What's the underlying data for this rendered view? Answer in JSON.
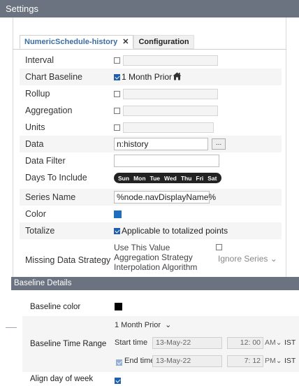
{
  "window": {
    "title": "Settings"
  },
  "tabs": [
    {
      "label": "NumericSchedule-history",
      "close": "✕"
    },
    {
      "label": "Configuration"
    }
  ],
  "rows": {
    "interval": "Interval",
    "chart_baseline": {
      "label": "Chart Baseline",
      "value": "1 Month Prior"
    },
    "rollup": "Rollup",
    "aggregation": "Aggregation",
    "units": "Units",
    "data": {
      "label": "Data",
      "value": "n:history",
      "button": "..."
    },
    "data_filter": "Data Filter",
    "days_to_include": {
      "label": "Days To Include",
      "days": [
        "Sun",
        "Mon",
        "Tue",
        "Wed",
        "Thu",
        "Fri",
        "Sat"
      ]
    },
    "series_name": {
      "label": "Series Name",
      "value": "%node.navDisplayName%"
    },
    "color": {
      "label": "Color",
      "value": "#1f6fbf"
    },
    "totalize": {
      "label": "Totalize",
      "value": "Applicable to totalized points"
    },
    "missing_data": {
      "label": "Missing Data Strategy",
      "line1": "Use This Value",
      "line2": "Aggregation Strategy",
      "line3": "Interpolation Algorithm",
      "select": "Ignore Series",
      "chevron": "⌄"
    }
  },
  "baseline": {
    "title": "Baseline Details",
    "color": {
      "label": "Baseline color",
      "value": "#000000"
    },
    "time_range": {
      "label": "Baseline Time Range",
      "select": "1 Month Prior",
      "chevron": "⌄",
      "start_label": "Start time",
      "start_date": "13-May-22",
      "start_hour": "12",
      "start_minute": "00",
      "start_ampm": "AM",
      "end_label": "End time",
      "end_date": "13-May-22",
      "end_hour": "7",
      "end_minute": "12",
      "end_ampm": "PM",
      "sep": ":",
      "tz": "IST"
    },
    "align_dow": {
      "label": "Align day of week"
    }
  }
}
